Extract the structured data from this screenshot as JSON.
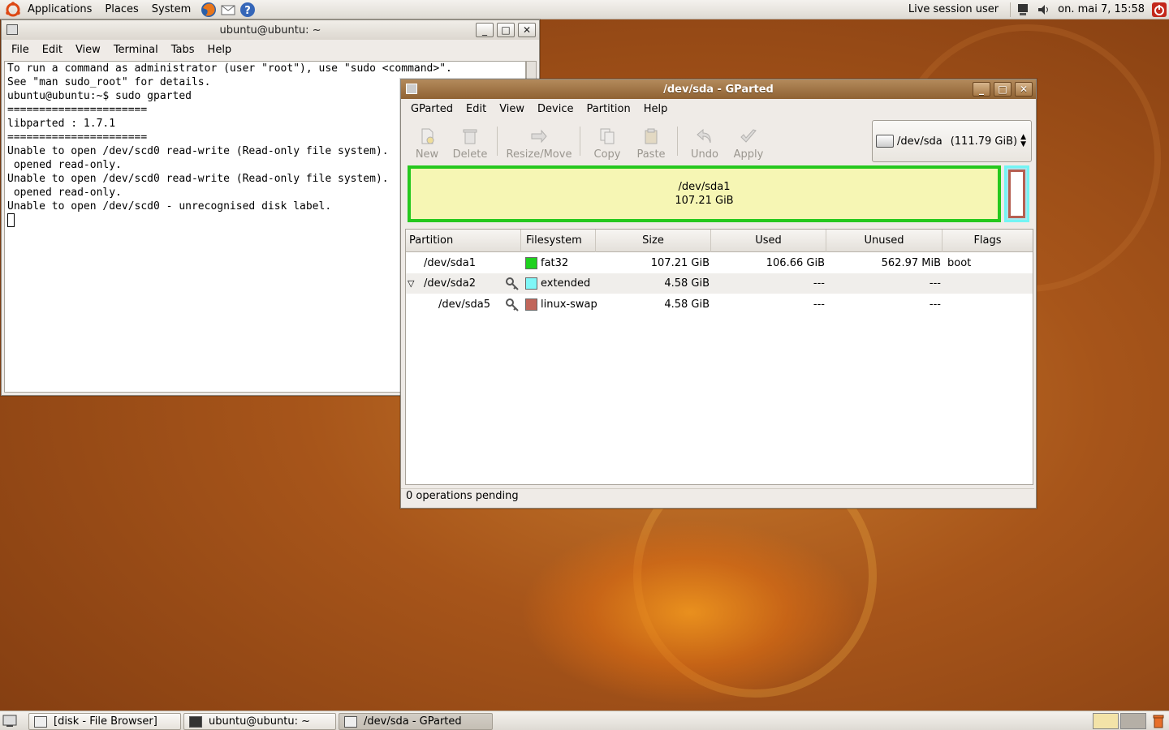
{
  "top_panel": {
    "menus": [
      "Applications",
      "Places",
      "System"
    ],
    "user": "Live session user",
    "clock": "on. mai  7, 15:58"
  },
  "terminal": {
    "title": "ubuntu@ubuntu: ~",
    "menus": [
      "File",
      "Edit",
      "View",
      "Terminal",
      "Tabs",
      "Help"
    ],
    "lines": [
      "To run a command as administrator (user \"root\"), use \"sudo <command>\".",
      "See \"man sudo_root\" for details.",
      "",
      "ubuntu@ubuntu:~$ sudo gparted",
      "======================",
      "libparted : 1.7.1",
      "======================",
      "Unable to open /dev/scd0 read-write (Read-only file system).  /dev/scd0 has been",
      " opened read-only.",
      "Unable to open /dev/scd0 read-write (Read-only file system).  /dev/scd0 has been",
      " opened read-only.",
      "Unable to open /dev/scd0 - unrecognised disk label."
    ]
  },
  "gparted": {
    "title": "/dev/sda - GParted",
    "menus": [
      "GParted",
      "Edit",
      "View",
      "Device",
      "Partition",
      "Help"
    ],
    "toolbar": [
      "New",
      "Delete",
      "Resize/Move",
      "Copy",
      "Paste",
      "Undo",
      "Apply"
    ],
    "device": "/dev/sda",
    "device_size": "(111.79 GiB)",
    "diskmap": {
      "name": "/dev/sda1",
      "size": "107.21 GiB"
    },
    "columns": [
      "Partition",
      "Filesystem",
      "Size",
      "Used",
      "Unused",
      "Flags"
    ],
    "rows": [
      {
        "partition": "/dev/sda1",
        "filesystem": "fat32",
        "color": "#1ed11e",
        "size": "107.21 GiB",
        "used": "106.66 GiB",
        "unused": "562.97 MiB",
        "flags": "boot"
      },
      {
        "partition": "/dev/sda2",
        "filesystem": "extended",
        "color": "#7ff7f7",
        "size": "4.58 GiB",
        "used": "---",
        "unused": "---",
        "flags": ""
      },
      {
        "partition": "/dev/sda5",
        "filesystem": "linux-swap",
        "color": "#c1665a",
        "size": "4.58 GiB",
        "used": "---",
        "unused": "---",
        "flags": ""
      }
    ],
    "status": "0 operations pending"
  },
  "taskbar": {
    "tasks": [
      "[disk - File Browser]",
      "ubuntu@ubuntu: ~",
      "/dev/sda - GParted"
    ]
  }
}
